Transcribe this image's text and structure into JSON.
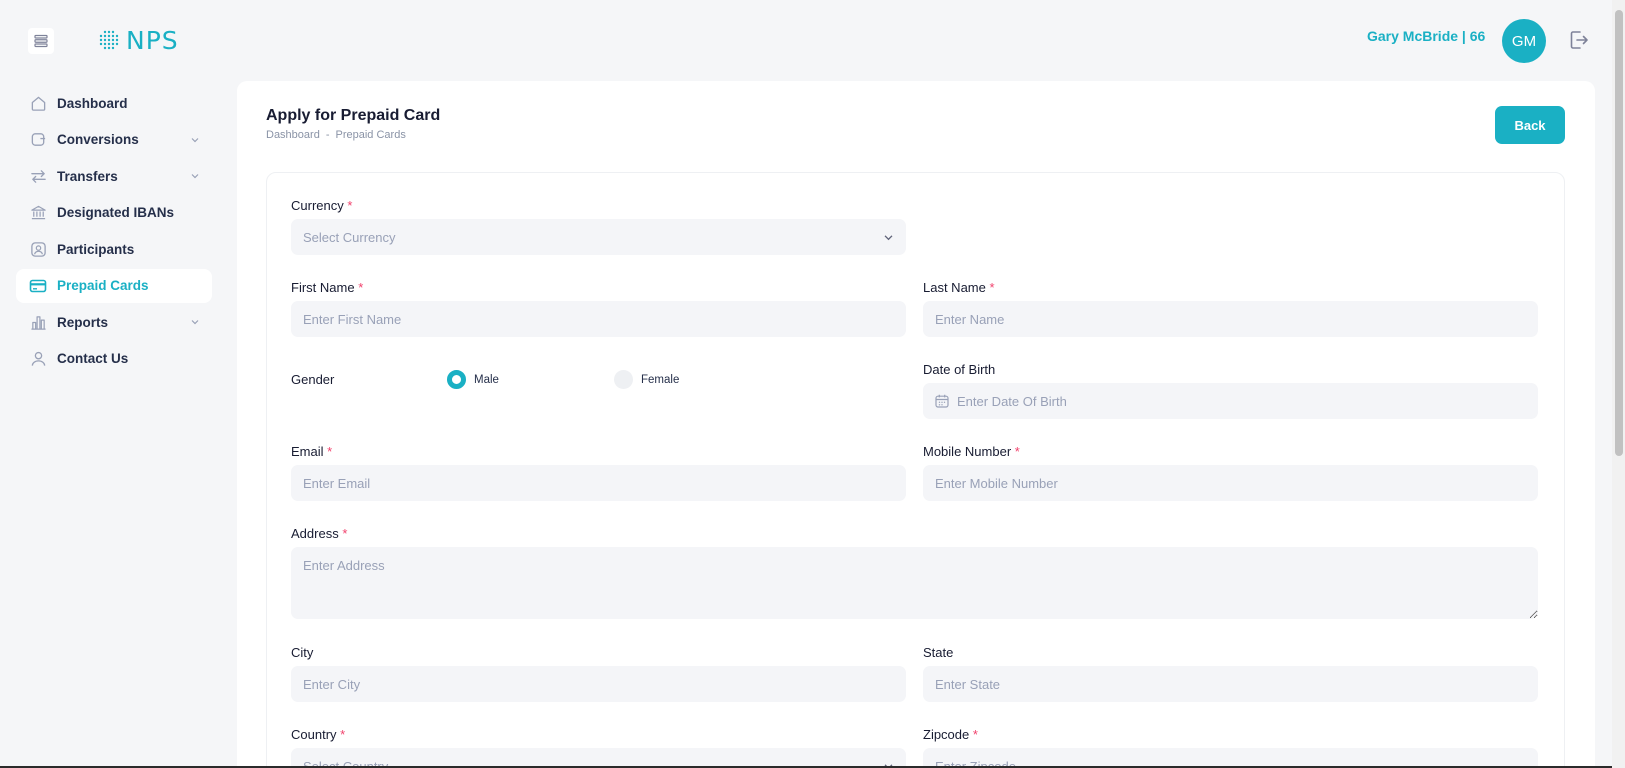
{
  "header": {
    "logo_text": "NPS",
    "user_name": "Gary McBride | 66",
    "avatar_initials": "GM"
  },
  "sidebar": {
    "items": [
      {
        "label": "Dashboard",
        "icon": "home-icon",
        "has_chevron": false
      },
      {
        "label": "Conversions",
        "icon": "conversion-icon",
        "has_chevron": true
      },
      {
        "label": "Transfers",
        "icon": "transfer-arrows-icon",
        "has_chevron": true
      },
      {
        "label": "Designated IBANs",
        "icon": "bank-icon",
        "has_chevron": false
      },
      {
        "label": "Participants",
        "icon": "person-badge-icon",
        "has_chevron": false
      },
      {
        "label": "Prepaid Cards",
        "icon": "credit-card-icon",
        "has_chevron": false,
        "active": true
      },
      {
        "label": "Reports",
        "icon": "bar-chart-icon",
        "has_chevron": true
      },
      {
        "label": "Contact Us",
        "icon": "user-icon",
        "has_chevron": false
      }
    ]
  },
  "page": {
    "title": "Apply for Prepaid Card",
    "breadcrumb": [
      "Dashboard",
      "Prepaid Cards"
    ],
    "back_label": "Back"
  },
  "form": {
    "currency": {
      "label": "Currency",
      "placeholder": "Select Currency"
    },
    "first_name": {
      "label": "First Name",
      "placeholder": "Enter First Name"
    },
    "last_name": {
      "label": "Last Name",
      "placeholder": "Enter Name"
    },
    "gender": {
      "label": "Gender",
      "options": [
        "Male",
        "Female"
      ],
      "selected": "Male"
    },
    "dob": {
      "label": "Date of Birth",
      "placeholder": "Enter Date Of Birth"
    },
    "email": {
      "label": "Email",
      "placeholder": "Enter Email"
    },
    "mobile": {
      "label": "Mobile Number",
      "placeholder": "Enter Mobile Number"
    },
    "address": {
      "label": "Address",
      "placeholder": "Enter Address"
    },
    "city": {
      "label": "City",
      "placeholder": "Enter City"
    },
    "state": {
      "label": "State",
      "placeholder": "Enter State"
    },
    "country": {
      "label": "Country",
      "placeholder": "Select Country"
    },
    "zipcode": {
      "label": "Zipcode",
      "placeholder": "Enter Zipcode"
    },
    "required_mark": "*"
  },
  "colors": {
    "accent": "#1ab0c4",
    "required": "#f1416c",
    "input_bg": "#f4f5f8"
  }
}
